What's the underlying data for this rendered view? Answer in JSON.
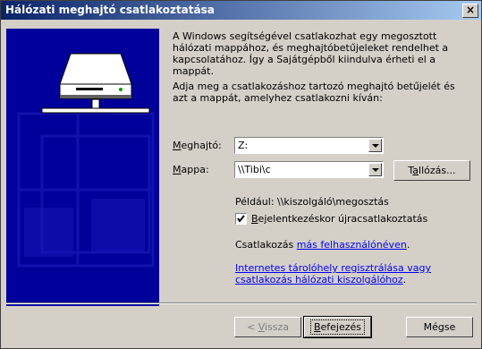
{
  "title": "Hálózati meghajtó csatlakoztatása",
  "close_label": "×",
  "description": {
    "paragraph1": "A Windows segítségével csatlakozhat egy megosztott hálózati mappához, és meghajtóbetűjeleket rendelhet a kapcsolatához. Így a Sajátgépből kiindulva érheti el a mappát.",
    "paragraph2": "Adja meg a csatlakozáshoz tartozó meghajtó betűjelét és azt a mappát, amelyhez csatlakozni kíván:"
  },
  "drive": {
    "label_prefix": "M",
    "label_rest": "eghajtó:",
    "value": "Z:"
  },
  "folder": {
    "label_prefix": "M",
    "label_rest": "appa:",
    "value": "\\\\Tibi\\c"
  },
  "browse": {
    "pre": "T",
    "u": "a",
    "post": "llózás..."
  },
  "example": "Például: \\\\kiszolgáló\\megosztás",
  "reconnect": {
    "checked": true,
    "label_prefix": "B",
    "label_rest": "ejelentkezéskor újracsatlakoztatás"
  },
  "connect_as": {
    "prefix": "Csatlakozás ",
    "link": "más felhasználónéven",
    "suffix": "."
  },
  "internet_link": {
    "line1": "Internetes tárolóhely regisztrálása vagy",
    "line2": "csatlakozás hálózati kiszolgálóhoz"
  },
  "internet_suffix": ".",
  "buttons": {
    "back": {
      "pre": "< ",
      "u": "V",
      "post": "issza"
    },
    "finish": {
      "u": "B",
      "post": "efejezés"
    },
    "cancel": "Mégse"
  }
}
